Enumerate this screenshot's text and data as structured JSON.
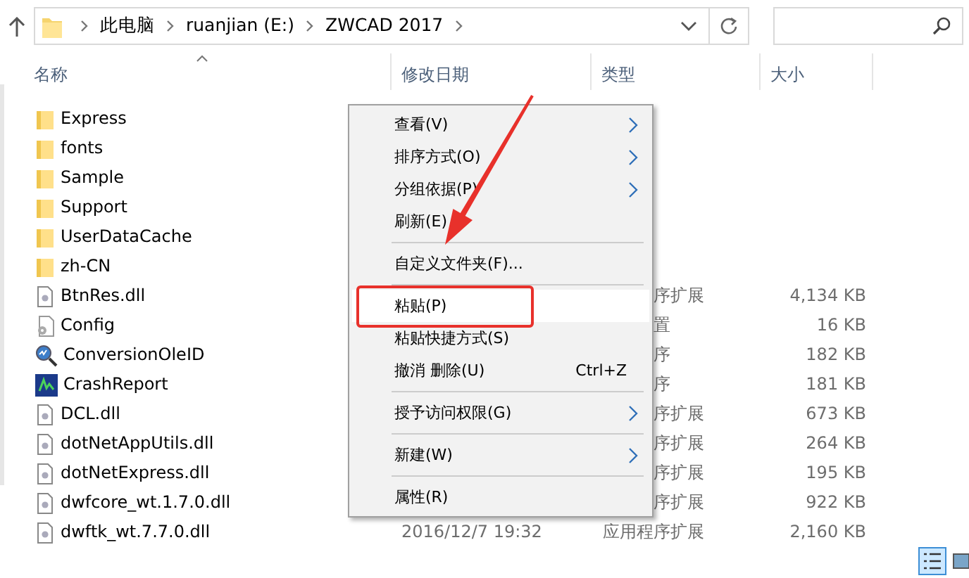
{
  "address": {
    "crumbs": [
      "此电脑",
      "ruanjian (E:)",
      "ZWCAD 2017"
    ]
  },
  "columns": [
    {
      "label": "名称",
      "sorted": true
    },
    {
      "label": "修改日期",
      "sorted": false
    },
    {
      "label": "类型",
      "sorted": false
    },
    {
      "label": "大小",
      "sorted": false
    }
  ],
  "files": [
    {
      "kind": "folder",
      "name": "Express"
    },
    {
      "kind": "folder",
      "name": "fonts"
    },
    {
      "kind": "folder",
      "name": "Sample"
    },
    {
      "kind": "folder",
      "name": "Support"
    },
    {
      "kind": "folder",
      "name": "UserDataCache"
    },
    {
      "kind": "folder",
      "name": "zh-CN"
    },
    {
      "kind": "dll",
      "name": "BtnRes.dll",
      "type": "序扩展",
      "size": "4,134 KB"
    },
    {
      "kind": "config",
      "name": "Config",
      "type": "置",
      "size": "16 KB"
    },
    {
      "kind": "search-app",
      "name": "ConversionOleID",
      "type": "序",
      "size": "182 KB"
    },
    {
      "kind": "report-app",
      "name": "CrashReport",
      "type": "序",
      "size": "181 KB"
    },
    {
      "kind": "dll",
      "name": "DCL.dll",
      "type": "序扩展",
      "size": "673 KB"
    },
    {
      "kind": "dll",
      "name": "dotNetAppUtils.dll",
      "type": "序扩展",
      "size": "264 KB"
    },
    {
      "kind": "dll",
      "name": "dotNetExpress.dll",
      "type": "序扩展",
      "size": "195 KB"
    },
    {
      "kind": "dll",
      "name": "dwfcore_wt.1.7.0.dll",
      "type": "序扩展",
      "size": "922 KB"
    },
    {
      "kind": "dll",
      "name": "dwftk_wt.7.7.0.dll",
      "date": "2016/12/7 19:32",
      "type": "应用程序扩展",
      "size": "2,160 KB"
    }
  ],
  "context_menu": [
    {
      "kind": "item",
      "label": "查看(V)",
      "submenu": true,
      "selected": false
    },
    {
      "kind": "item",
      "label": "排序方式(O)",
      "submenu": true,
      "selected": false
    },
    {
      "kind": "item",
      "label": "分组依据(P)",
      "submenu": true,
      "selected": false
    },
    {
      "kind": "item",
      "label": "刷新(E)",
      "submenu": false,
      "selected": false
    },
    {
      "kind": "separator"
    },
    {
      "kind": "item",
      "label": "自定义文件夹(F)...",
      "submenu": false,
      "selected": false
    },
    {
      "kind": "separator"
    },
    {
      "kind": "item",
      "label": "粘贴(P)",
      "submenu": false,
      "selected": true
    },
    {
      "kind": "item",
      "label": "粘贴快捷方式(S)",
      "submenu": false,
      "selected": false
    },
    {
      "kind": "item",
      "label": "撤消 删除(U)",
      "shortcut": "Ctrl+Z",
      "submenu": false,
      "selected": false
    },
    {
      "kind": "separator"
    },
    {
      "kind": "item",
      "label": "授予访问权限(G)",
      "submenu": true,
      "selected": false
    },
    {
      "kind": "separator"
    },
    {
      "kind": "item",
      "label": "新建(W)",
      "submenu": true,
      "selected": false
    },
    {
      "kind": "separator"
    },
    {
      "kind": "item",
      "label": "属性(R)",
      "submenu": false,
      "selected": false
    }
  ]
}
